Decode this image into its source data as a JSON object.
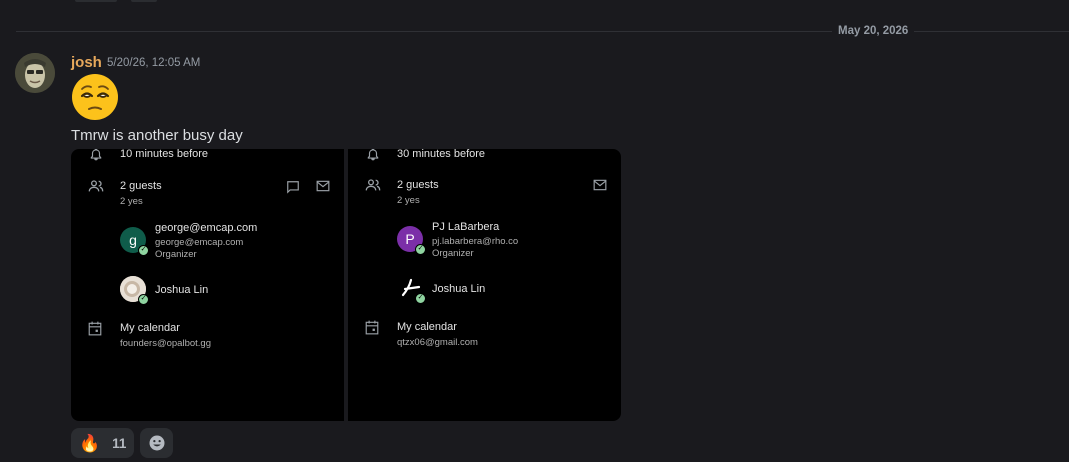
{
  "divider": {
    "date": "May 20, 2026"
  },
  "message": {
    "author": "josh",
    "timestamp": "5/20/26, 12:05 AM",
    "text": "Tmrw is another busy day",
    "emoji_icon": "relieved-face-emoji"
  },
  "events": [
    {
      "reminder": "10 minutes before",
      "guests_title": "2 guests",
      "guests_sub": "2 yes",
      "guests": [
        {
          "initial": "g",
          "name": "george@emcap.com",
          "email": "george@emcap.com",
          "role": "Organizer",
          "color": "#0f5c4a"
        },
        {
          "name": "Joshua Lin"
        }
      ],
      "calendar_title": "My calendar",
      "calendar_sub": "founders@opalbot.gg"
    },
    {
      "reminder": "30 minutes before",
      "guests_title": "2 guests",
      "guests_sub": "2 yes",
      "guests": [
        {
          "initial": "P",
          "name": "PJ LaBarbera",
          "email": "pj.labarbera@rho.co",
          "role": "Organizer",
          "color": "#7b2fa8"
        },
        {
          "name": "Joshua Lin"
        }
      ],
      "calendar_title": "My calendar",
      "calendar_sub": "qtzx06@gmail.com"
    }
  ],
  "reactions": [
    {
      "emoji": "🔥",
      "count": "11"
    }
  ]
}
